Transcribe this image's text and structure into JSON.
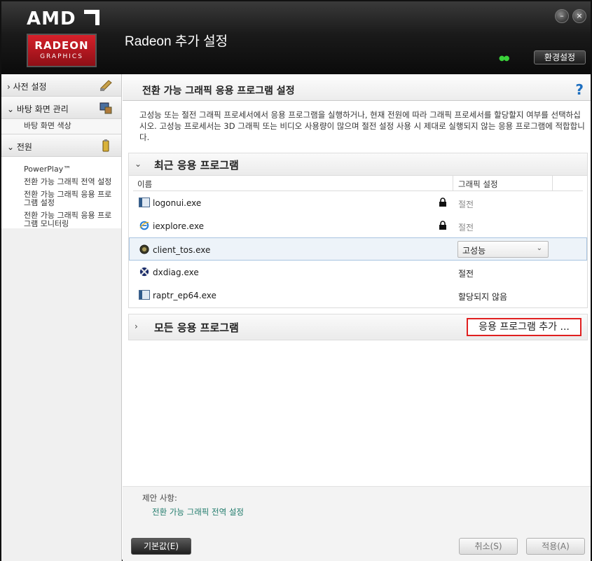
{
  "header": {
    "logo_text": "AMD",
    "logo_radeon": "RADEON",
    "logo_graphics": "GRAPHICS",
    "title": "Radeon 추가 설정",
    "minimize_glyph": "–",
    "close_glyph": "×",
    "status_dots": "●●",
    "preferences_label": "환경설정"
  },
  "sidebar": {
    "groups": [
      {
        "label": "› 사전 설정",
        "icon": "presets-icon"
      },
      {
        "label": "⌄ 바탕 화면 관리",
        "icon": "desktop-management-icon"
      },
      {
        "label": "⌄ 전원",
        "icon": "power-icon"
      }
    ],
    "desktop_sub": "바탕 화면 색상",
    "power_items": [
      "PowerPlay™",
      "전환 가능 그래픽 전역 설정",
      "전환 가능 그래픽 응용 프로그램 설정",
      "전환 가능 그래픽 응용 프로그램 모니터링"
    ]
  },
  "main": {
    "title": "전환 가능 그래픽 응용 프로그램 설정",
    "help_glyph": "?",
    "description": "고성능 또는 절전 그래픽 프로세서에서 응용 프로그램을 실행하거나, 현재 전원에 따라 그래픽 프로세서를 할당할지 여부를 선택하십시오. 고성능 프로세서는 3D 그래픽 또는 비디오 사용량이 많으며 절전 설정 사용 시 제대로 실행되지 않는 응용 프로그램에 적합합니다.",
    "recent": {
      "arrow": "⌄",
      "title": "최근 응용 프로그램",
      "col_name": "이름",
      "col_setting": "그래픽 설정",
      "rows": [
        {
          "name": "logonui.exe",
          "setting": "절전",
          "locked": true
        },
        {
          "name": "iexplore.exe",
          "setting": "절전",
          "locked": true
        },
        {
          "name": "client_tos.exe",
          "setting": "고성능",
          "locked": false
        },
        {
          "name": "dxdiag.exe",
          "setting": "절전",
          "locked": false
        },
        {
          "name": "raptr_ep64.exe",
          "setting": "할당되지 않음",
          "locked": false
        }
      ],
      "dropdown_chevron": "⌄"
    },
    "all": {
      "arrow": "›",
      "title": "모든 응용 프로그램",
      "add_label": "응용 프로그램 추가 ..."
    },
    "suggestions": {
      "label": "제안 사항:",
      "link": "전환 가능 그래픽 전역 설정"
    },
    "footer": {
      "default_label": "기본값(E)",
      "cancel_label": "취소(S)",
      "apply_label": "적용(A)"
    }
  },
  "colors": {
    "accent_link": "#1e7a6a",
    "highlight_border": "#e02020",
    "help_blue": "#1d6fc0",
    "logo_red": "#d6202a"
  }
}
